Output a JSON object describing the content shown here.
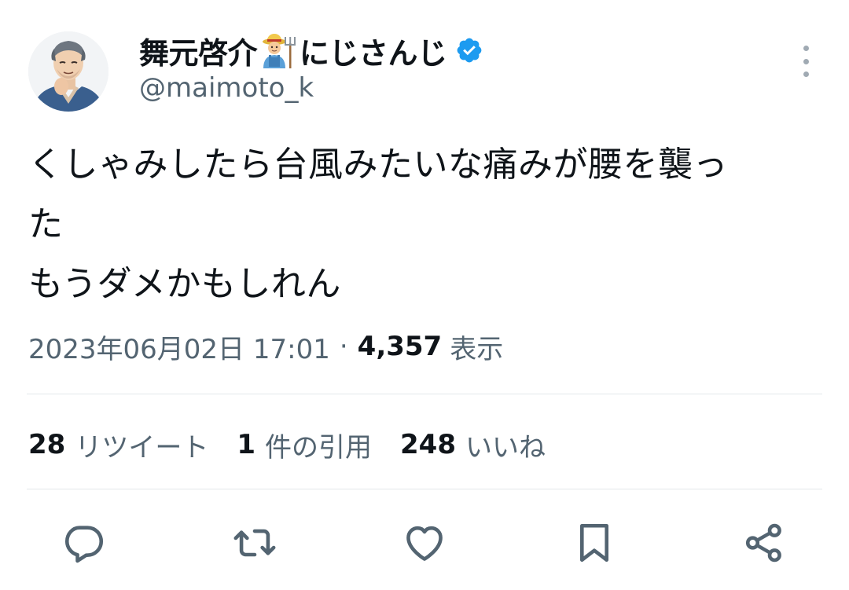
{
  "author": {
    "display_name": "舞元啓介",
    "name_suffix": "にじさんじ",
    "name_emoji": "farmer-emoji",
    "handle": "@maimoto_k",
    "verified": true,
    "verified_color": "#1d9bf0"
  },
  "tweet": {
    "lines": [
      "くしゃみしたら台風みたいな痛みが腰を襲っ",
      "た",
      "もうダメかもしれん"
    ]
  },
  "meta": {
    "timestamp": "2023年06月02日 17:01",
    "separator": "·",
    "views_count": "4,357",
    "views_label": "表示"
  },
  "stats": {
    "retweets_count": "28",
    "retweets_label": "リツイート",
    "quotes_count": "1",
    "quotes_label": "件の引用",
    "likes_count": "248",
    "likes_label": "いいね"
  },
  "actions": [
    {
      "name": "reply",
      "icon": "reply-icon"
    },
    {
      "name": "retweet",
      "icon": "retweet-icon"
    },
    {
      "name": "like",
      "icon": "heart-icon"
    },
    {
      "name": "bookmark",
      "icon": "bookmark-icon"
    },
    {
      "name": "share",
      "icon": "share-icon"
    }
  ],
  "colors": {
    "text_primary": "#0f1419",
    "text_secondary": "#536471",
    "divider": "#e3e7ea",
    "accent": "#1d9bf0"
  }
}
